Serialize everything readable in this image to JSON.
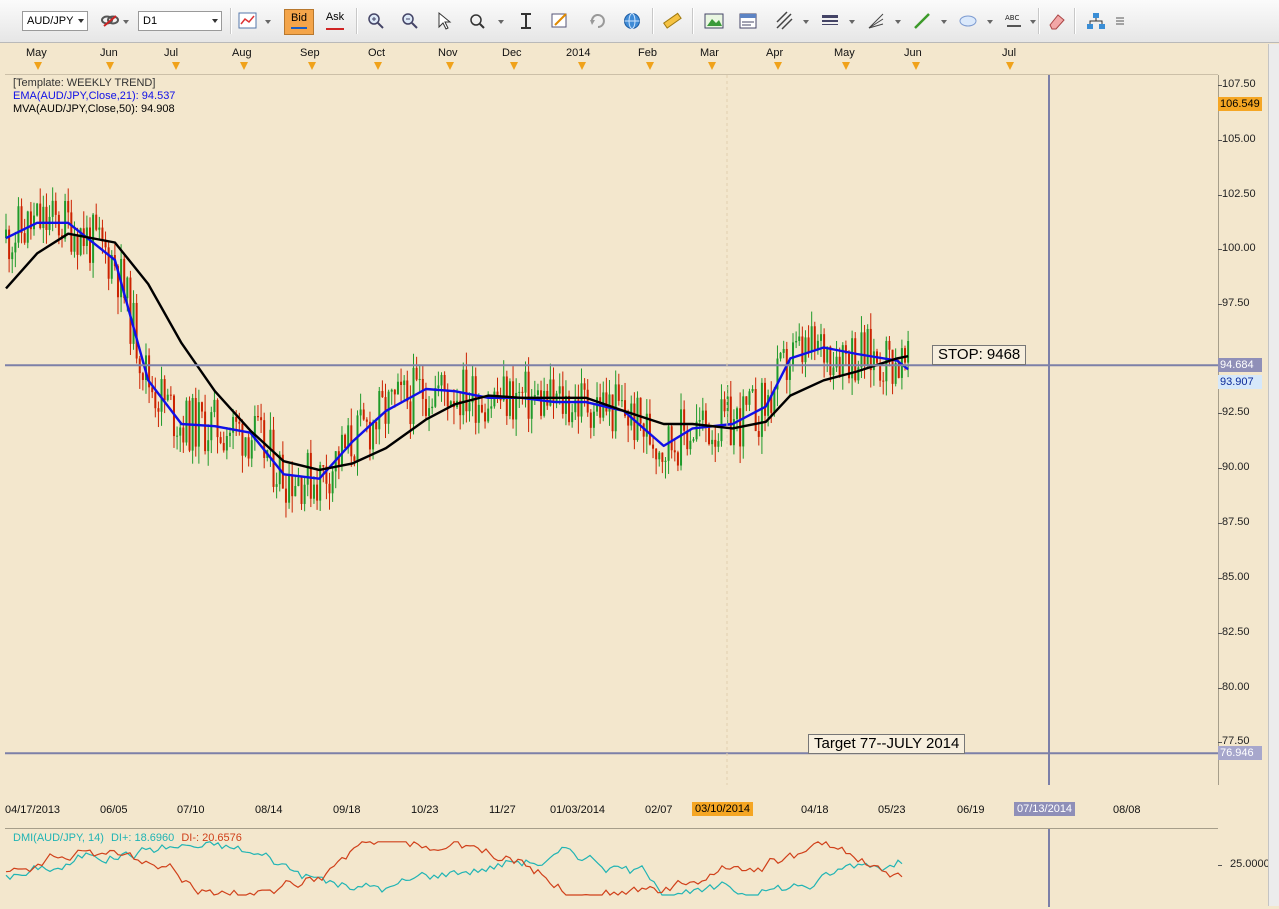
{
  "toolbar": {
    "symbol": "AUD/JPY",
    "timeframe": "D1",
    "bid_label": "Bid",
    "ask_label": "Ask",
    "icons": [
      "chart-type-icon",
      "bid-icon",
      "ask-icon",
      "zoom-in-icon",
      "zoom-out-icon",
      "cursor-icon",
      "magnify-icon",
      "crosshair-icon",
      "draw-icon",
      "refresh-icon",
      "globe-icon",
      "ruler-icon",
      "picture-icon",
      "template-icon",
      "fork-icon",
      "lines-icon",
      "fan-icon",
      "trendline-icon",
      "ellipse-icon",
      "text-icon",
      "eraser-icon",
      "hierarchy-icon",
      "menu-icon"
    ]
  },
  "top_axis": {
    "months": [
      "May",
      "Jun",
      "Jul",
      "Aug",
      "Sep",
      "Oct",
      "Nov",
      "Dec",
      "2014",
      "Feb",
      "Mar",
      "Apr",
      "May",
      "Jun",
      "Jul"
    ]
  },
  "legend": {
    "template": "[Template: WEEKLY TREND]",
    "ema": "EMA(AUD/JPY,Close,21): 94.537",
    "mva": "MVA(AUD/JPY,Close,50): 94.908"
  },
  "price_axis": {
    "ticks": [
      "107.50",
      "105.00",
      "102.50",
      "100.00",
      "97.50",
      "92.50",
      "90.00",
      "87.50",
      "85.00",
      "82.50",
      "80.00",
      "77.50"
    ],
    "tags": {
      "top": "106.549",
      "stop": "94.684",
      "last": "93.907",
      "target": "76.946"
    },
    "tag_colors": {
      "top": "#f5a623",
      "stop": "#8f8fb8",
      "last": "#d6e8fa",
      "target": "#a7a7cc"
    }
  },
  "annotations": {
    "stop": "STOP: 9468",
    "target": "Target 77--JULY 2014"
  },
  "x_axis": {
    "labels": [
      "04/17/2013",
      "06/05",
      "07/10",
      "08/14",
      "09/18",
      "10/23",
      "11/27",
      "01/03/2014",
      "02/07",
      "04/18",
      "05/23",
      "06/19",
      "08/08"
    ],
    "highlight_date": "03/10/2014",
    "highlight2_date": "07/13/2014"
  },
  "dmi": {
    "title": "DMI(AUD/JPY, 14)",
    "di_plus": "DI+: 18.6960",
    "di_minus": "DI-: 20.6576",
    "level": "25.0000"
  },
  "colors": {
    "background": "#f3e7cd",
    "ema": "#1010e8",
    "mva": "#000000",
    "bull": "#1f9a2a",
    "bear": "#cc2200",
    "hline": "#7c80a8",
    "di_plus": "#20b4b4",
    "di_minus": "#d0401a"
  },
  "chart_data": {
    "type": "line",
    "symbol": "AUD/JPY",
    "timeframe": "D1",
    "y_axis_range": [
      75,
      108.5
    ],
    "x": [
      "2013-04-17",
      "2013-05-01",
      "2013-05-15",
      "2013-06-05",
      "2013-06-20",
      "2013-07-05",
      "2013-07-20",
      "2013-08-05",
      "2013-08-20",
      "2013-09-05",
      "2013-09-20",
      "2013-10-05",
      "2013-10-23",
      "2013-11-05",
      "2013-11-20",
      "2013-12-05",
      "2013-12-20",
      "2014-01-03",
      "2014-01-20",
      "2014-02-07",
      "2014-02-20",
      "2014-03-10",
      "2014-03-25",
      "2014-04-05",
      "2014-04-20",
      "2014-05-05",
      "2014-05-23",
      "2014-05-28"
    ],
    "series": [
      {
        "name": "EMA(AUD/JPY,Close,21)",
        "values": [
          100.5,
          101.2,
          101.2,
          99.5,
          94.0,
          92.0,
          91.9,
          91.6,
          89.7,
          89.5,
          91.2,
          92.6,
          93.6,
          93.5,
          93.2,
          93.2,
          93.0,
          93.0,
          92.6,
          91.0,
          91.8,
          92.0,
          92.8,
          95.0,
          95.5,
          95.2,
          94.9,
          94.5
        ]
      },
      {
        "name": "MVA(AUD/JPY,Close,50)",
        "values": [
          98.2,
          99.8,
          100.7,
          100.3,
          98.4,
          95.7,
          93.5,
          91.7,
          90.3,
          89.9,
          90.2,
          90.9,
          92.2,
          92.9,
          93.3,
          93.2,
          93.2,
          93.2,
          92.6,
          92.0,
          92.0,
          91.8,
          92.1,
          93.3,
          94.0,
          94.4,
          95.0,
          95.1
        ]
      }
    ],
    "horizontal_lines": [
      {
        "label": "STOP: 9468",
        "value": 94.684
      },
      {
        "label": "Target 77--JULY 2014",
        "value": 76.946
      }
    ],
    "vertical_lines": [
      "2014-03-10",
      "2014-07-13"
    ],
    "dmi": {
      "period": 14,
      "di_plus_last": 18.696,
      "di_minus_last": 20.6576,
      "reference_level": 25.0
    }
  }
}
